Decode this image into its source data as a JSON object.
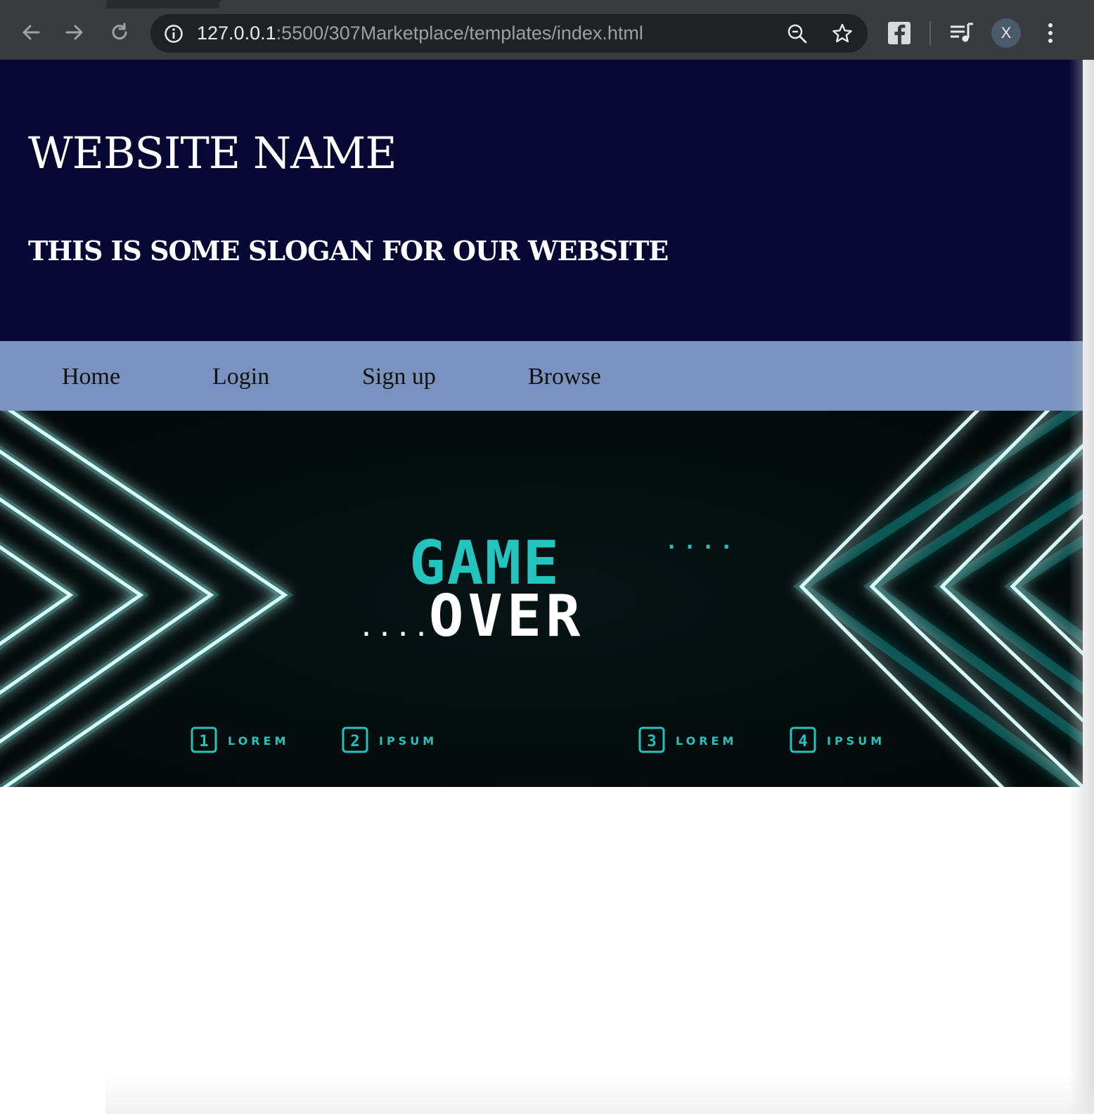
{
  "browser": {
    "url_host": "127.0.0.1",
    "url_rest": ":5500/307Marketplace/templates/index.html",
    "profile_initial": "X",
    "icons": [
      "back-arrow-icon",
      "forward-arrow-icon",
      "reload-icon",
      "info-icon",
      "zoom-icon",
      "star-icon",
      "facebook-extension-icon",
      "media-queue-icon",
      "more-vert-icon"
    ]
  },
  "site": {
    "title": "WEBSITE NAME",
    "slogan": "THIS IS SOME SLOGAN FOR OUR WEBSITE",
    "nav": [
      "Home",
      "Login",
      "Sign up",
      "Browse"
    ]
  },
  "banner": {
    "word1": "GAME",
    "word2": "OVER",
    "dots_after_word1": "....",
    "dots_before_word2": "....",
    "items": [
      {
        "num": "1",
        "label": "LOREM"
      },
      {
        "num": "2",
        "label": "IPSUM"
      },
      {
        "num": "3",
        "label": "LOREM"
      },
      {
        "num": "4",
        "label": "IPSUM"
      }
    ]
  },
  "colors": {
    "header_bg": "#070733",
    "nav_bg": "#7a92bf",
    "banner_bg": "#040f10",
    "neon": "#22c4bd"
  }
}
